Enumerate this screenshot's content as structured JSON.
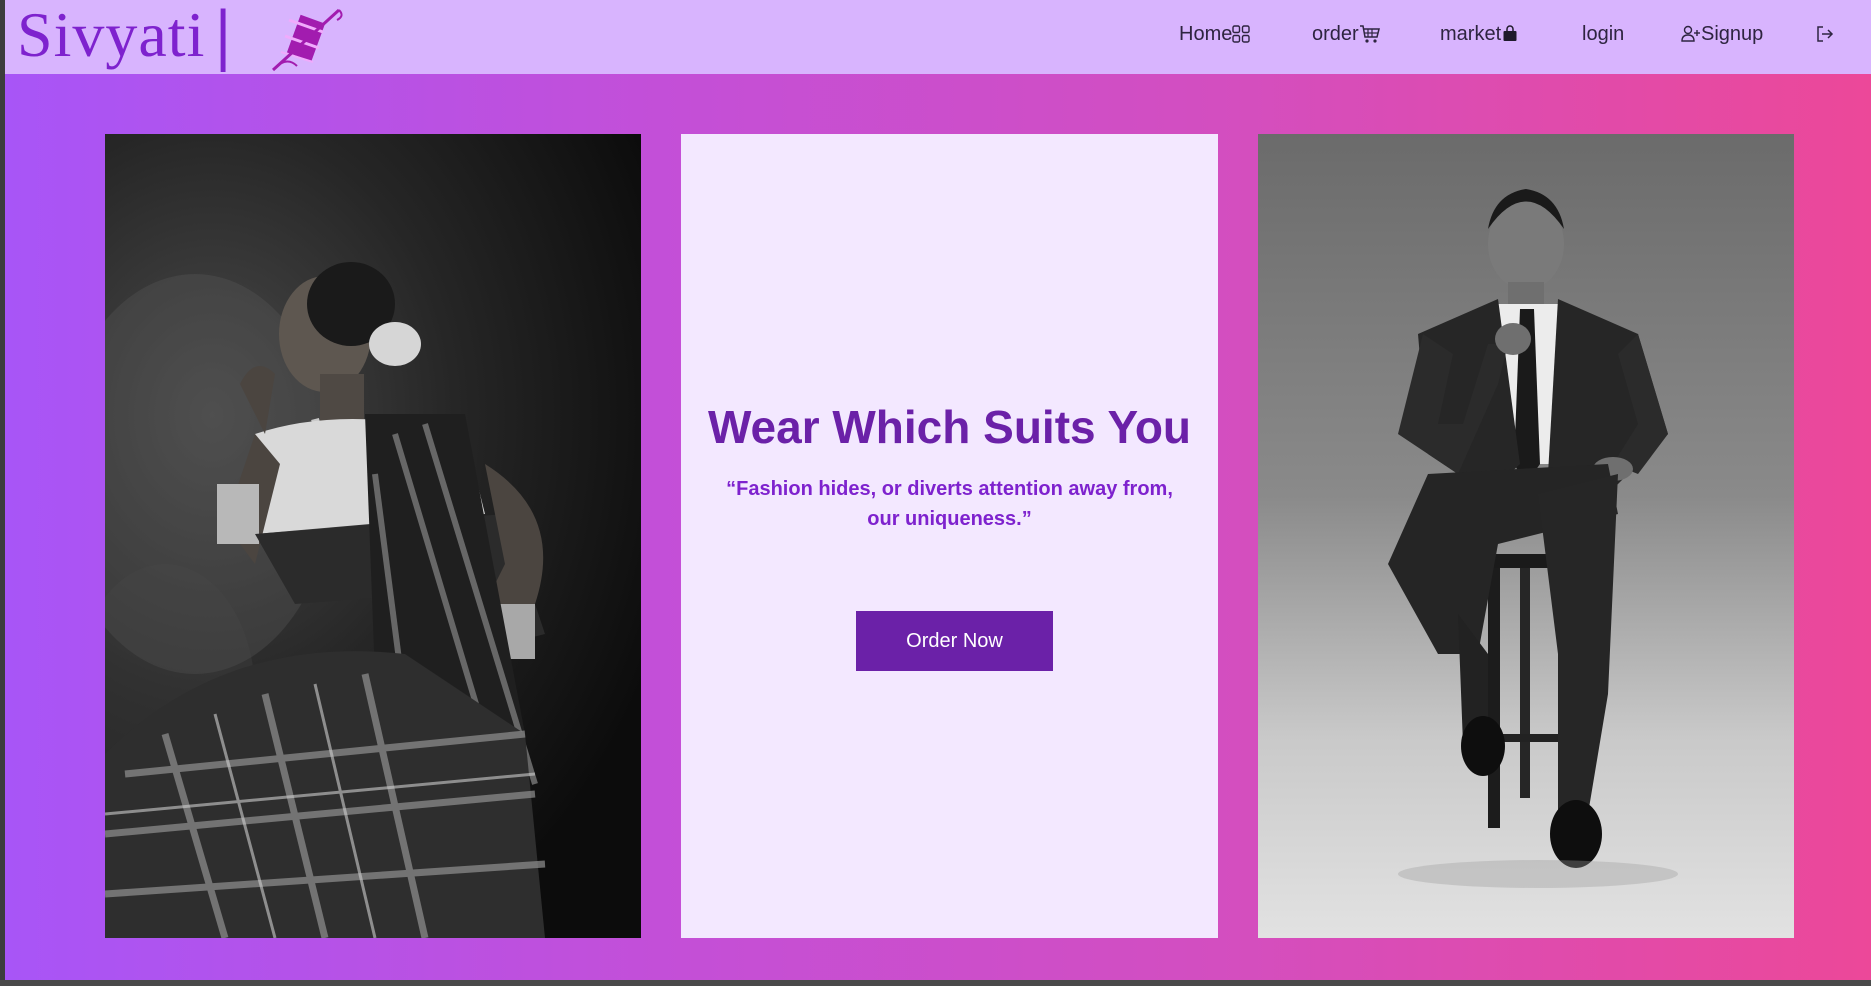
{
  "brand": {
    "name": "Sivyati",
    "separator": "|",
    "logo_icon": "needle-thread-icon",
    "accent_color": "#7e22ce"
  },
  "nav": {
    "home": {
      "label": "Home",
      "icon": "grid-icon"
    },
    "order": {
      "label": "order",
      "icon": "cart-icon"
    },
    "market": {
      "label": "market",
      "icon": "bag-icon"
    },
    "login": {
      "label": "login"
    },
    "signup": {
      "label": "Signup",
      "icon": "person-plus-icon"
    },
    "logout": {
      "icon": "logout-icon"
    }
  },
  "hero": {
    "headline": "Wear Which Suits You",
    "quote": "“Fashion hides, or diverts attention away from, our uniqueness.”",
    "cta_label": "Order Now",
    "left_image": "black-and-white photo of woman in saree with jewelry",
    "right_image": "black-and-white photo of man in suit seated on stool"
  },
  "colors": {
    "navbar": "#d8b4fe",
    "gradient_start": "#a855f7",
    "gradient_end": "#ec4899",
    "card_bg": "#f3e8ff",
    "primary": "#6b21a8"
  }
}
